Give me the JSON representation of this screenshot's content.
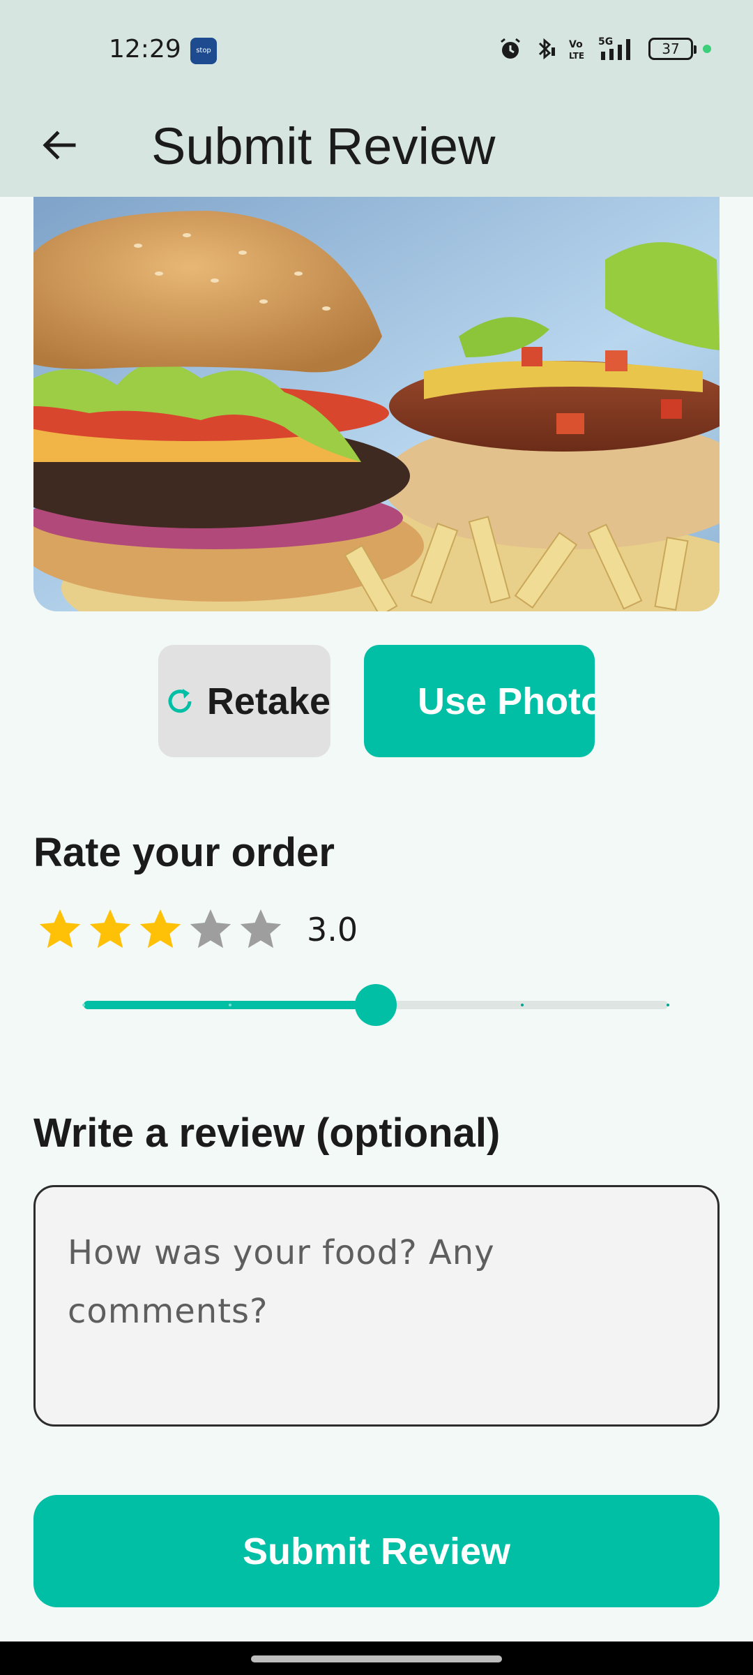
{
  "status_bar": {
    "time": "12:29",
    "app_badge": "stop",
    "battery": "37",
    "icons": [
      "alarm-icon",
      "bluetooth-icon",
      "volte-icon",
      "signal-5g-icon",
      "battery-icon"
    ]
  },
  "app_bar": {
    "back_icon": "arrow-left-icon",
    "title": "Submit Review"
  },
  "photo": {
    "subject": "burger-and-hotdog-photo"
  },
  "photo_actions": {
    "retake_label": "Retake",
    "use_photo_label": "Use Photo"
  },
  "rating": {
    "heading": "Rate your order",
    "value_text": "3.0",
    "value": 3,
    "max": 5,
    "slider_min": 1,
    "slider_max": 5,
    "filled_star_color": "#FFC107",
    "empty_star_color": "#9E9E9E"
  },
  "review": {
    "heading": "Write a review (optional)",
    "placeholder": "How was your food? Any comments?",
    "value": ""
  },
  "submit": {
    "label": "Submit Review"
  },
  "colors": {
    "accent": "#00BFA5",
    "top_bar": "#D7E5E0",
    "background": "#F3F9F6"
  }
}
